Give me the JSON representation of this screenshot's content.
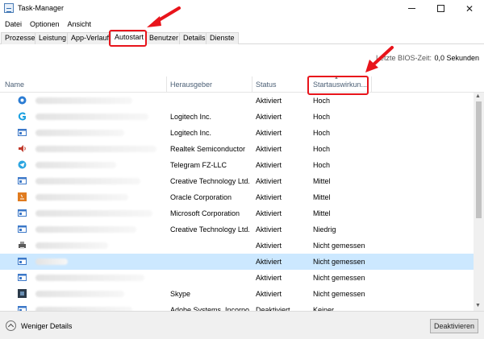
{
  "window": {
    "title": "Task-Manager"
  },
  "menu": [
    "Datei",
    "Optionen",
    "Ansicht"
  ],
  "tabs": [
    "Prozesse",
    "Leistung",
    "App-Verlauf",
    "Autostart",
    "Benutzer",
    "Details",
    "Dienste"
  ],
  "active_tab": "Autostart",
  "bios": {
    "label": "Letzte BIOS-Zeit:",
    "value": "0,0 Sekunden"
  },
  "columns": {
    "name": "Name",
    "publisher": "Herausgeber",
    "status": "Status",
    "impact": "Startauswirkun..."
  },
  "rows": [
    {
      "icon": "blue-circle-icon",
      "icon_color": "#2b7cd3",
      "publisher": "",
      "status": "Aktiviert",
      "impact": "Hoch"
    },
    {
      "icon": "logitech-g-icon",
      "icon_color": "#1aa0e0",
      "publisher": "Logitech Inc.",
      "status": "Aktiviert",
      "impact": "Hoch"
    },
    {
      "icon": "app-window-icon",
      "icon_color": "#3c78c8",
      "publisher": "Logitech Inc.",
      "status": "Aktiviert",
      "impact": "Hoch"
    },
    {
      "icon": "speaker-icon",
      "icon_color": "#c0392b",
      "publisher": "Realtek Semiconductor",
      "status": "Aktiviert",
      "impact": "Hoch"
    },
    {
      "icon": "telegram-icon",
      "icon_color": "#2ca5e0",
      "publisher": "Telegram FZ-LLC",
      "status": "Aktiviert",
      "impact": "Hoch"
    },
    {
      "icon": "app-window-icon",
      "icon_color": "#3c78c8",
      "publisher": "Creative Technology Ltd.",
      "status": "Aktiviert",
      "impact": "Mittel"
    },
    {
      "icon": "java-icon",
      "icon_color": "#e07b1f",
      "publisher": "Oracle Corporation",
      "status": "Aktiviert",
      "impact": "Mittel"
    },
    {
      "icon": "app-window-icon",
      "icon_color": "#3c78c8",
      "publisher": "Microsoft Corporation",
      "status": "Aktiviert",
      "impact": "Mittel"
    },
    {
      "icon": "app-window-icon",
      "icon_color": "#3c78c8",
      "publisher": "Creative Technology Ltd.",
      "status": "Aktiviert",
      "impact": "Niedrig"
    },
    {
      "icon": "printer-icon",
      "icon_color": "#5a5a5a",
      "publisher": "",
      "status": "Aktiviert",
      "impact": "Nicht gemessen"
    },
    {
      "icon": "app-window-icon",
      "icon_color": "#3c78c8",
      "publisher": "",
      "status": "Aktiviert",
      "impact": "Nicht gemessen"
    },
    {
      "icon": "app-window-icon",
      "icon_color": "#3c78c8",
      "publisher": "",
      "status": "Aktiviert",
      "impact": "Nicht gemessen"
    },
    {
      "icon": "dark-square-icon",
      "icon_color": "#2b3a4a",
      "publisher": "Skype",
      "status": "Aktiviert",
      "impact": "Nicht gemessen"
    },
    {
      "icon": "app-window-icon",
      "icon_color": "#3c78c8",
      "publisher": "Adobe Systems, Incorpo...",
      "status": "Deaktiviert",
      "impact": "Keiner"
    }
  ],
  "selected_row": 10,
  "footer": {
    "fewer_details": "Weniger Details",
    "deactivate": "Deaktivieren"
  },
  "colors": {
    "highlight": "#e8141b",
    "selection": "#cce8ff",
    "header_text": "#4c6076"
  }
}
